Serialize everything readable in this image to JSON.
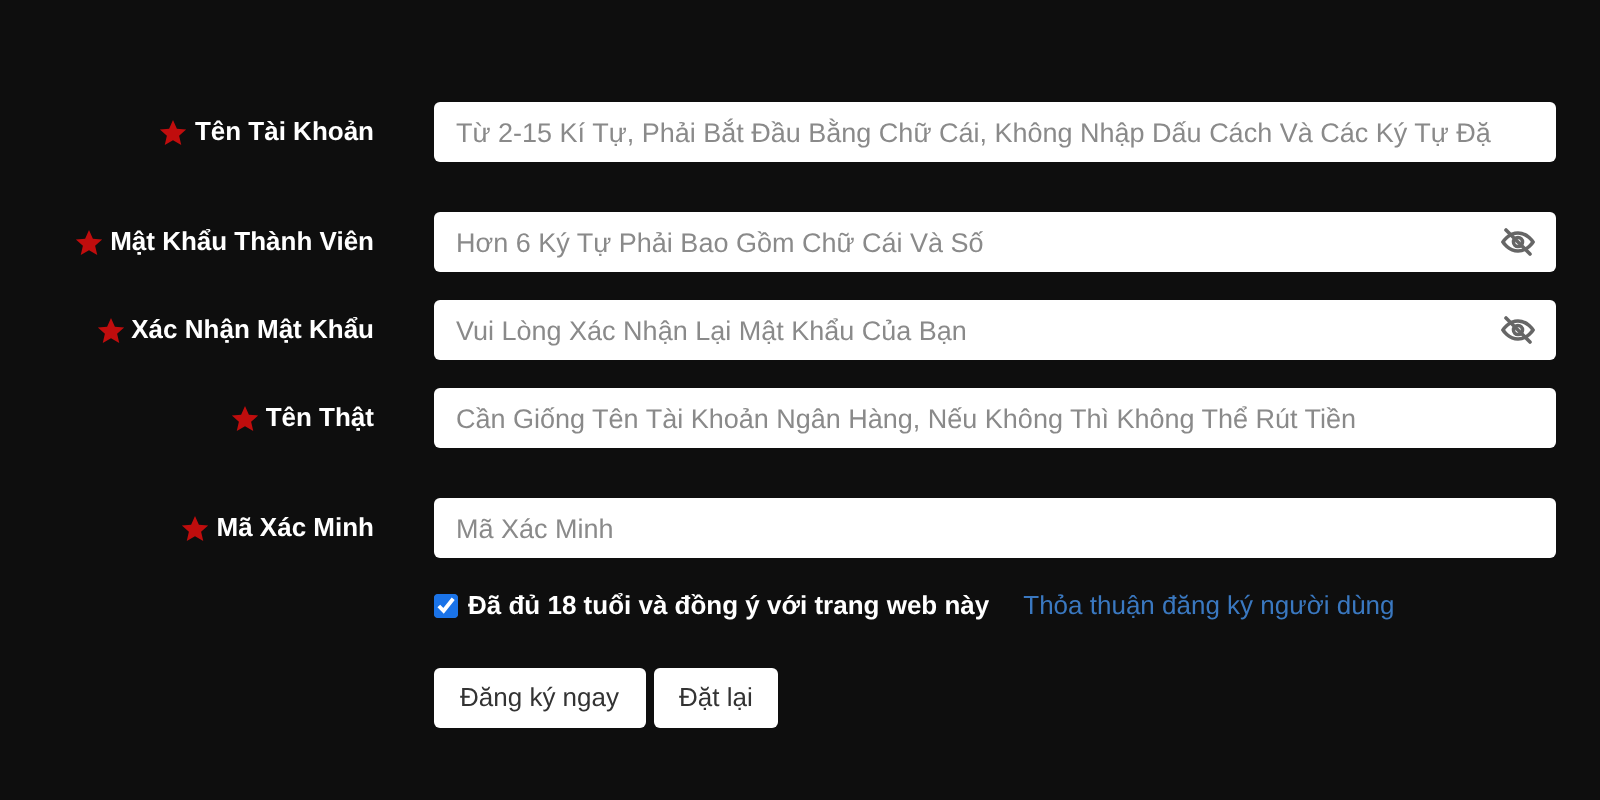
{
  "fields": [
    {
      "label": "Tên Tài Khoản",
      "required": true,
      "kind": "text",
      "placeholder": "Từ 2-15 Kí Tự, Phải Bắt Đầu Bằng Chữ Cái, Không Nhập Dấu Cách Và Các Ký Tự Đặ"
    },
    {
      "label": "Mật Khẩu Thành Viên",
      "required": true,
      "kind": "password",
      "placeholder": "Hơn 6 Ký Tự Phải Bao Gồm Chữ Cái Và Số"
    },
    {
      "label": "Xác Nhận Mật Khẩu",
      "required": true,
      "kind": "password",
      "placeholder": "Vui Lòng Xác Nhận Lại Mật Khẩu Của Bạn"
    },
    {
      "label": "Tên Thật",
      "required": true,
      "kind": "text",
      "placeholder": "Cần Giống Tên Tài Khoản Ngân Hàng, Nếu Không Thì Không Thể Rút Tiền"
    },
    {
      "label": "Mã Xác Minh",
      "required": true,
      "kind": "text",
      "placeholder": "Mã Xác Minh"
    }
  ],
  "agreement": {
    "checked": true,
    "label": "Đã đủ 18 tuổi và đồng ý với trang web này",
    "link": "Thỏa thuận đăng ký người dùng"
  },
  "buttons": [
    "Đăng ký ngay",
    "Đặt lại"
  ]
}
